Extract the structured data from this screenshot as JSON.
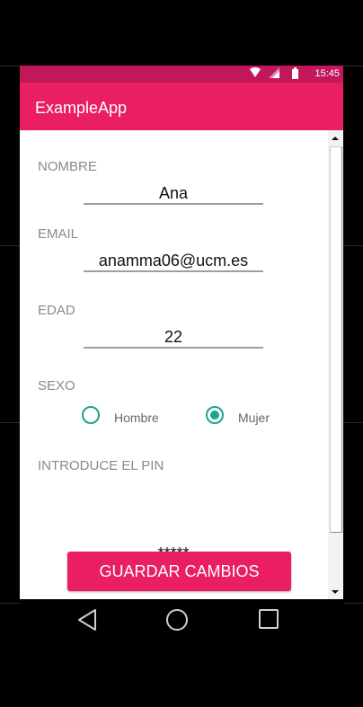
{
  "status_bar": {
    "time": "15:45",
    "icons": [
      "wifi-icon",
      "signal-icon",
      "battery-icon"
    ]
  },
  "app_bar": {
    "title": "ExampleApp"
  },
  "form": {
    "nombre": {
      "label": "NOMBRE",
      "value": "Ana"
    },
    "email": {
      "label": "EMAIL",
      "value": "anamma06@ucm.es"
    },
    "edad": {
      "label": "EDAD",
      "value": "22"
    },
    "sexo": {
      "label": "SEXO",
      "options": [
        "Hombre",
        "Mujer"
      ],
      "selected": "Mujer"
    },
    "pin": {
      "label": "INTRODUCE EL PIN",
      "value": "*****"
    }
  },
  "save_button": {
    "label": "GUARDAR CAMBIOS"
  },
  "nav_bar": {
    "icons": [
      "back-icon",
      "home-icon",
      "recents-icon"
    ]
  },
  "colors": {
    "primary": "#e91e63",
    "primary_dark": "#c2185b",
    "accent": "#1aa393",
    "label_gray": "#8a8a8a"
  }
}
